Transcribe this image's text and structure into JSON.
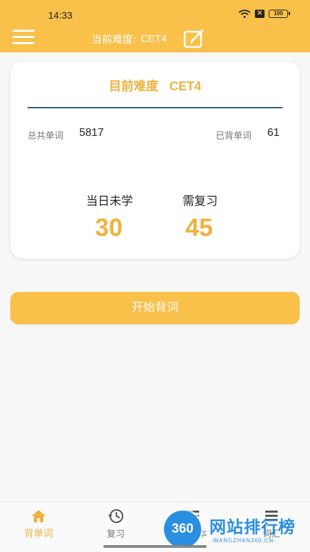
{
  "status_bar": {
    "time": "14:33",
    "battery": "100"
  },
  "header": {
    "title_label": "当前难度:",
    "level": "CET4"
  },
  "card": {
    "title_label": "目前难度",
    "level": "CET4",
    "total_words_label": "总共单词",
    "total_words_value": "5817",
    "memorized_label": "已背单词",
    "memorized_value": "61",
    "unlearned_today_label": "当日未学",
    "unlearned_today_value": "30",
    "need_review_label": "需复习",
    "need_review_value": "45"
  },
  "start_button": {
    "label": "开始背词"
  },
  "bottom_nav": {
    "items": [
      {
        "label": "背单词",
        "icon": "home-icon",
        "active": true
      },
      {
        "label": "复习",
        "icon": "history-icon",
        "active": false
      },
      {
        "label": "本",
        "icon": "list-icon",
        "active": false
      },
      {
        "label": "词汇",
        "icon": "list-icon",
        "active": false
      }
    ]
  },
  "watermark": {
    "logo": "360",
    "text": "网站排行榜",
    "sub": "-WANGZHAN360.CN-"
  },
  "colors": {
    "accent": "#f9c04a",
    "accent_text": "#f0b23e",
    "divider": "#2b5f7a"
  }
}
